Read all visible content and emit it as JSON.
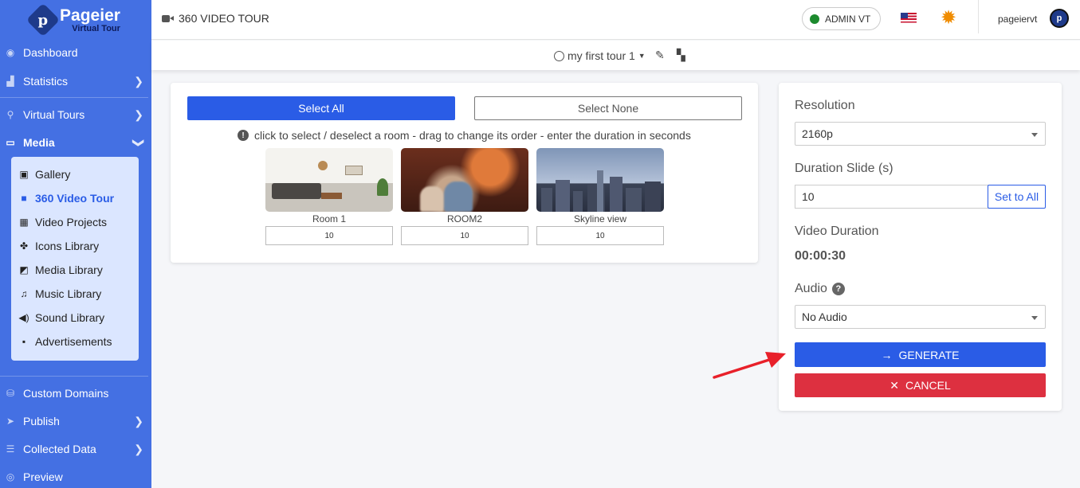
{
  "sidebar": {
    "logo_title": "Pageier",
    "logo_subtitle": "Virtual Tour",
    "logo_mark": "p",
    "items": [
      {
        "label": "Dashboard",
        "icon": "dashboard-icon"
      },
      {
        "label": "Statistics",
        "icon": "chart-icon"
      },
      {
        "label": "Virtual Tours",
        "icon": "route-icon"
      },
      {
        "label": "Media",
        "icon": "monitor-icon"
      },
      {
        "label": "Custom Domains",
        "icon": "sitemap-icon"
      },
      {
        "label": "Publish",
        "icon": "paper-plane-icon"
      },
      {
        "label": "Collected Data",
        "icon": "database-icon"
      },
      {
        "label": "Preview",
        "icon": "eye-icon"
      }
    ],
    "media_submenu": [
      {
        "label": "Gallery",
        "icon": "images-icon"
      },
      {
        "label": "360 Video Tour",
        "icon": "video-icon",
        "active": true
      },
      {
        "label": "Video Projects",
        "icon": "film-icon"
      },
      {
        "label": "Icons Library",
        "icon": "icons-icon"
      },
      {
        "label": "Media Library",
        "icon": "photo-video-icon"
      },
      {
        "label": "Music Library",
        "icon": "music-icon"
      },
      {
        "label": "Sound Library",
        "icon": "volume-icon"
      },
      {
        "label": "Advertisements",
        "icon": "ad-icon"
      }
    ]
  },
  "header": {
    "title": "360 VIDEO TOUR",
    "admin_label": "ADMIN VT",
    "username": "pageiervt",
    "avatar_letter": "p"
  },
  "subbar": {
    "tour_name": "my first tour 1"
  },
  "rooms_panel": {
    "select_all_label": "Select All",
    "select_none_label": "Select None",
    "hint": "click to select / deselect a room - drag to change its order - enter the duration in seconds",
    "rooms": [
      {
        "name": "Room 1",
        "duration": "10"
      },
      {
        "name": "ROOM2",
        "duration": "10"
      },
      {
        "name": "Skyline view",
        "duration": "10"
      }
    ]
  },
  "settings_panel": {
    "resolution_label": "Resolution",
    "resolution_value": "2160p",
    "duration_label": "Duration Slide (s)",
    "duration_value": "10",
    "set_all_label": "Set to All",
    "video_duration_label": "Video Duration",
    "video_duration_value": "00:00:30",
    "audio_label": "Audio",
    "audio_value": "No Audio",
    "generate_label": "GENERATE",
    "cancel_label": "CANCEL"
  },
  "colors": {
    "sidebar_bg": "#4470e3",
    "primary": "#2a5ce6",
    "danger": "#dd3040",
    "online": "#1c8a2e",
    "annotation_arrow": "#e8202a"
  }
}
